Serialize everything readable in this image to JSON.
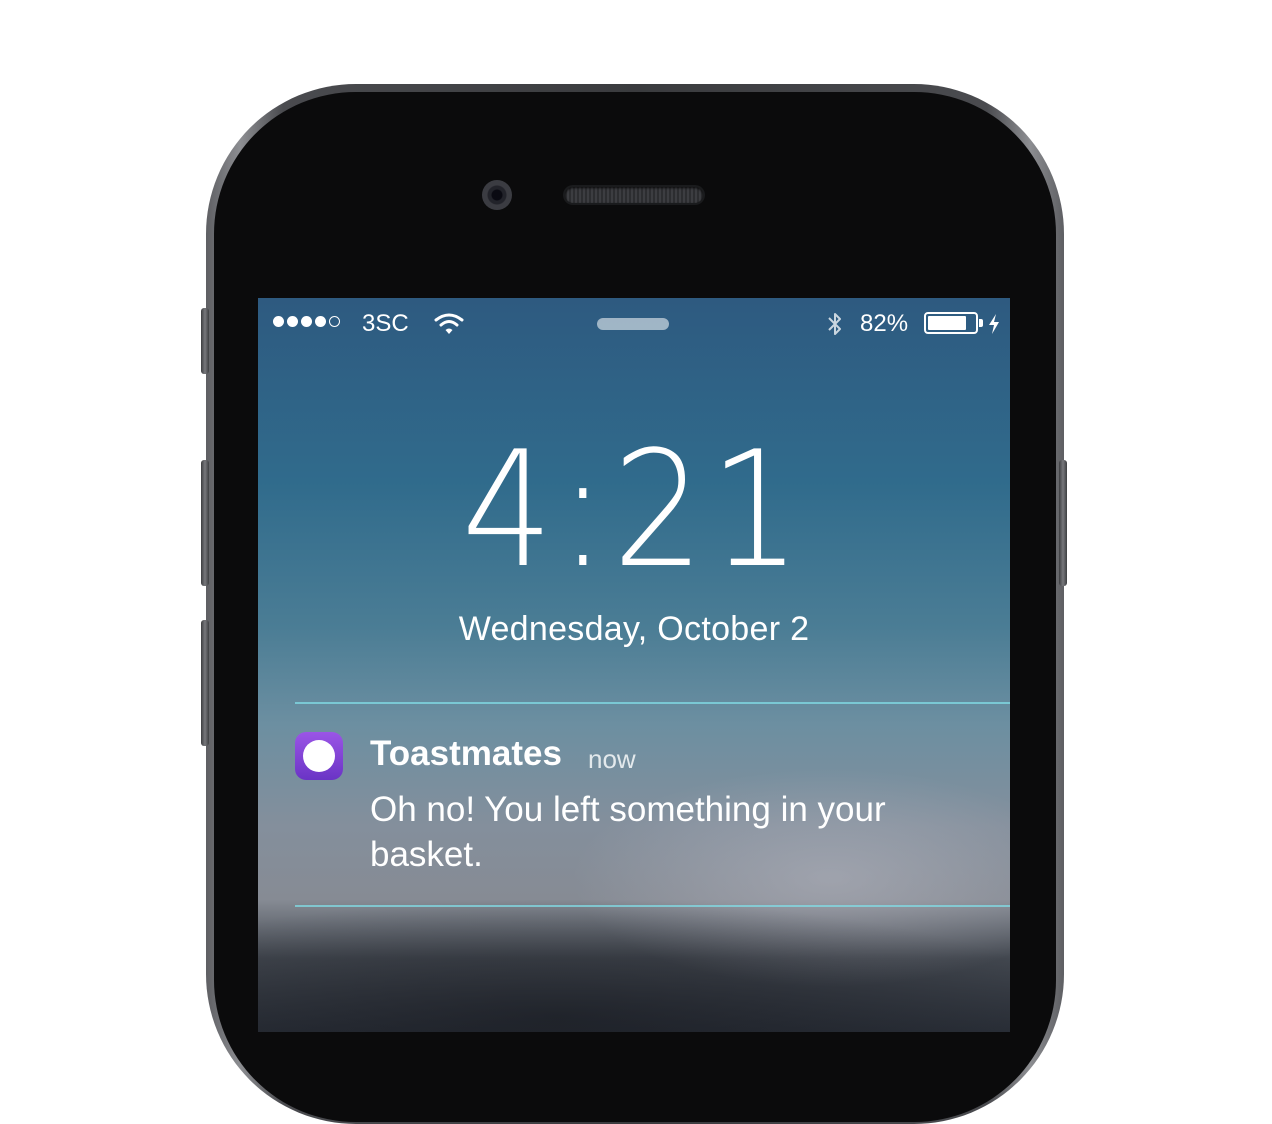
{
  "status_bar": {
    "signal_filled": 4,
    "signal_total": 5,
    "carrier": "3SC",
    "wifi_icon": "wifi-icon",
    "bluetooth_icon": "bluetooth-icon",
    "battery_percent_label": "82%",
    "battery_level": 0.82,
    "charging_icon": "charging-bolt-icon"
  },
  "lock_screen": {
    "time": "4:21",
    "date": "Wednesday, October 2"
  },
  "notification": {
    "app_icon": "toastmates-app-icon",
    "app_name": "Toastmates",
    "time": "now",
    "message": "Oh no! You left something in your basket."
  },
  "colors": {
    "screen_top": "#2e5a80",
    "screen_mid": "#4b7d95",
    "divider": "#82dce6",
    "app_icon_top": "#9b55e6",
    "app_icon_bottom": "#6a34c5"
  }
}
